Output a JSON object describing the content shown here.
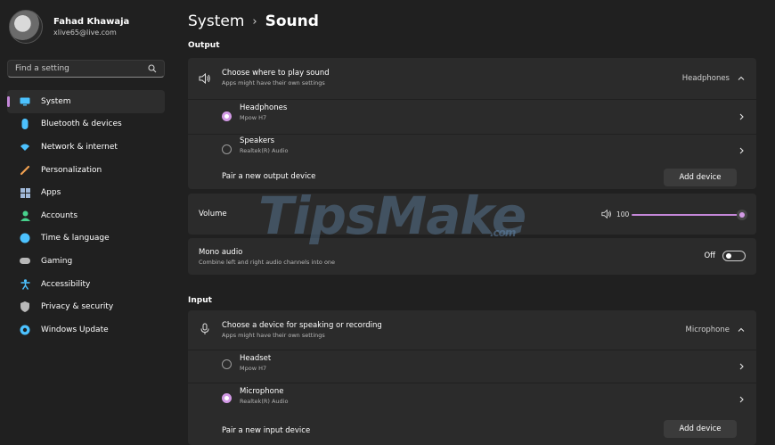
{
  "profile": {
    "name": "Fahad Khawaja",
    "email": "xlive65@live.com"
  },
  "search": {
    "placeholder": "Find a setting"
  },
  "nav": [
    {
      "label": "System",
      "icon": "monitor-icon",
      "color": "#4cc2ff",
      "active": true
    },
    {
      "label": "Bluetooth & devices",
      "icon": "bluetooth-icon",
      "color": "#4cc2ff"
    },
    {
      "label": "Network & internet",
      "icon": "wifi-icon",
      "color": "#4cc2ff"
    },
    {
      "label": "Personalization",
      "icon": "brush-icon",
      "color": "#f0a050"
    },
    {
      "label": "Apps",
      "icon": "apps-icon",
      "color": "#a0b8d8"
    },
    {
      "label": "Accounts",
      "icon": "person-icon",
      "color": "#47d18c"
    },
    {
      "label": "Time & language",
      "icon": "globe-clock-icon",
      "color": "#4cc2ff"
    },
    {
      "label": "Gaming",
      "icon": "gamepad-icon",
      "color": "#b8b8b8"
    },
    {
      "label": "Accessibility",
      "icon": "accessibility-icon",
      "color": "#4cc2ff"
    },
    {
      "label": "Privacy & security",
      "icon": "shield-icon",
      "color": "#b8b8b8"
    },
    {
      "label": "Windows Update",
      "icon": "update-icon",
      "color": "#4cc2ff"
    }
  ],
  "breadcrumb": {
    "parent": "System",
    "separator": "›",
    "current": "Sound"
  },
  "output": {
    "section_title": "Output",
    "choose_title": "Choose where to play sound",
    "choose_sub": "Apps might have their own settings",
    "selected_device": "Headphones",
    "devices": [
      {
        "name": "Headphones",
        "detail": "Mpow H7",
        "selected": true
      },
      {
        "name": "Speakers",
        "detail": "Realtek(R) Audio",
        "selected": false
      }
    ],
    "pair_label": "Pair a new output device",
    "add_button": "Add device"
  },
  "volume": {
    "label": "Volume",
    "value": "100",
    "level_percent": 100
  },
  "mono": {
    "title": "Mono audio",
    "sub": "Combine left and right audio channels into one",
    "state": "Off"
  },
  "input": {
    "section_title": "Input",
    "choose_title": "Choose a device for speaking or recording",
    "choose_sub": "Apps might have their own settings",
    "selected_device": "Microphone",
    "devices": [
      {
        "name": "Headset",
        "detail": "Mpow H7",
        "selected": false
      },
      {
        "name": "Microphone",
        "detail": "Realtek(R) Audio",
        "selected": true
      }
    ],
    "pair_label": "Pair a new input device",
    "add_button": "Add device"
  },
  "watermark": {
    "text": "TipsMake",
    "tld": ".com"
  },
  "colors": {
    "accent": "#c487d8",
    "background": "#202020",
    "card": "#2b2b2b"
  }
}
